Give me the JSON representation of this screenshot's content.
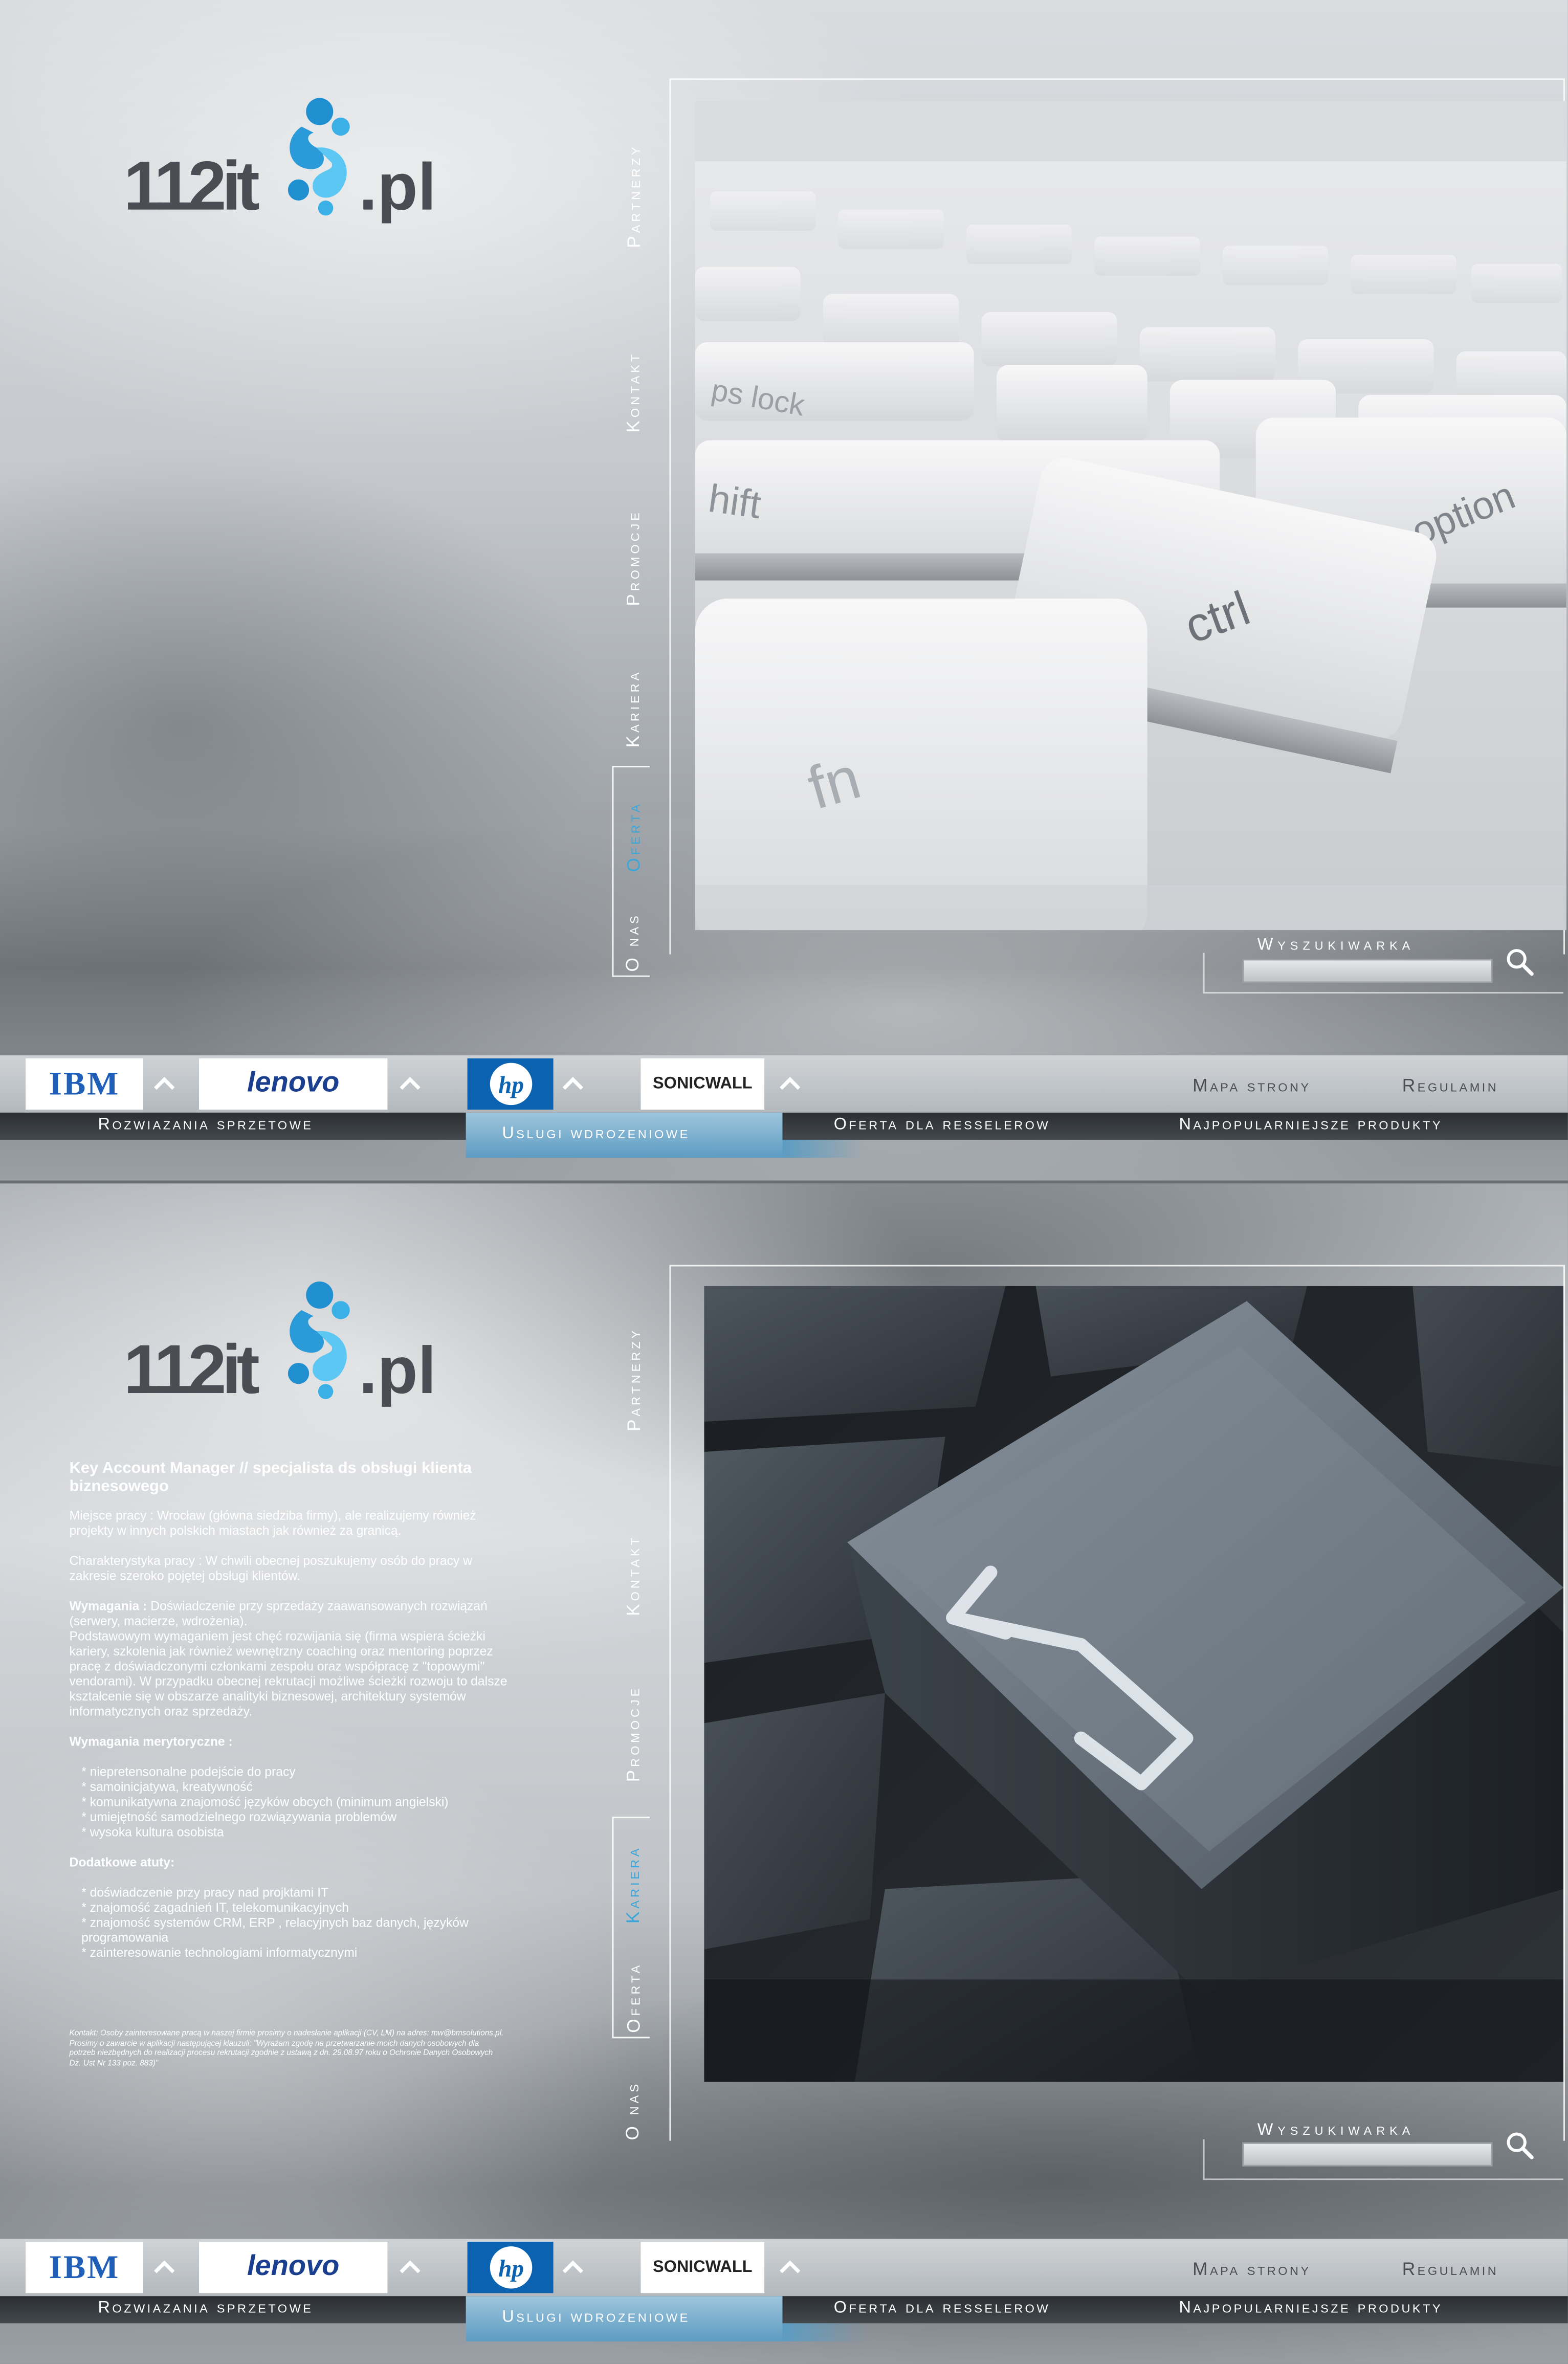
{
  "brand": {
    "logo_left": "112it",
    "logo_right": ".pl"
  },
  "nav": {
    "items": [
      "O nas",
      "Oferta",
      "Kariera",
      "Promocje",
      "Kontakt",
      "Partnerzy"
    ]
  },
  "panel1": {
    "active_nav": "Oferta",
    "hero_image": "laptop-keyboard-fn-ctrl-keys"
  },
  "panel2": {
    "active_nav": "Kariera",
    "hero_image": "dark-keyboard-enter-key"
  },
  "search": {
    "label": "Wyszukiwarka",
    "value": ""
  },
  "partners": [
    "IBM",
    "lenovo",
    "hp",
    "SONICWALL"
  ],
  "footer_links": {
    "sitemap": "Mapa strony",
    "rules": "Regulamin"
  },
  "bottom_nav": {
    "hardware": "Rozwiazania sprzetowe",
    "services": "Uslugi wdrozeniowe",
    "resellers": "Oferta dla resselerow",
    "popular": "Najpopularniejsze produkty",
    "active": "services"
  },
  "article": {
    "title": "Key Account Manager // specjalista ds obsługi klienta biznesowego",
    "location": "Miejsce pracy : Wrocław (główna siedziba firmy), ale realizujemy również projekty w innych polskich miastach jak również za granicą.",
    "characteristics": "Charakterystyka pracy : W chwili obecnej poszukujemy osób do pracy w zakresie szeroko pojętej obsługi klientów.",
    "requirements_label": "Wymagania :",
    "requirements_text": "Doświadczenie przy sprzedaży zaawansowanych rozwiązań (serwery, macierze, wdrożenia).",
    "requirements_more": "Podstawowym wymaganiem jest chęć rozwijania się (firma wspiera ścieżki kariery, szkolenia jak również wewnętrzny coaching oraz mentoring poprzez pracę z doświadczonymi członkami zespołu oraz współpracę z \"topowymi\" vendorami). W przypadku obecnej rekrutacji możliwe ścieżki rozwoju to dalsze kształcenie się w obszarze analityki biznesowej, architektury systemów informatycznych oraz sprzedaży.",
    "substantive_label": "Wymagania merytoryczne :",
    "substantive_items": [
      "* niepretensonalne podejście do pracy",
      "* samoinicjatywa, kreatywność",
      "* komunikatywna znajomość języków obcych (minimum angielski)",
      "* umiejętność samodzielnego rozwiązywania problemów",
      "* wysoka kultura osobista"
    ],
    "extras_label": "Dodatkowe atuty:",
    "extras_items": [
      "* doświadczenie przy pracy nad projktami IT",
      "* znajomość zagadnień IT, telekomunikacyjnych",
      "* znajomość systemów CRM, ERP , relacyjnych baz      danych, języków programowania",
      "* zainteresowanie technologiami informatycznymi"
    ],
    "footnote": "Kontakt: Osoby zainteresowane pracą w naszej firmie prosimy o nadesłanie aplikacji (CV, LM) na adres: mw@bmsolutions.pl. Prosimy o zawarcie w aplikacji następującej klauzuli: \"Wyrażam zgodę na przetwarzanie moich danych osobowych dla potrzeb niezbędnych do realizacji procesu rekrutacji zgodnie z ustawą z dn. 29.08.97 roku o Ochronie Danych Osobowych Dz. Ust Nr 133 poz. 883)\""
  },
  "colors": {
    "accent": "#3aa6d9",
    "logo_grey": "#4a4e54",
    "bar_dark": "#2b2f33"
  }
}
